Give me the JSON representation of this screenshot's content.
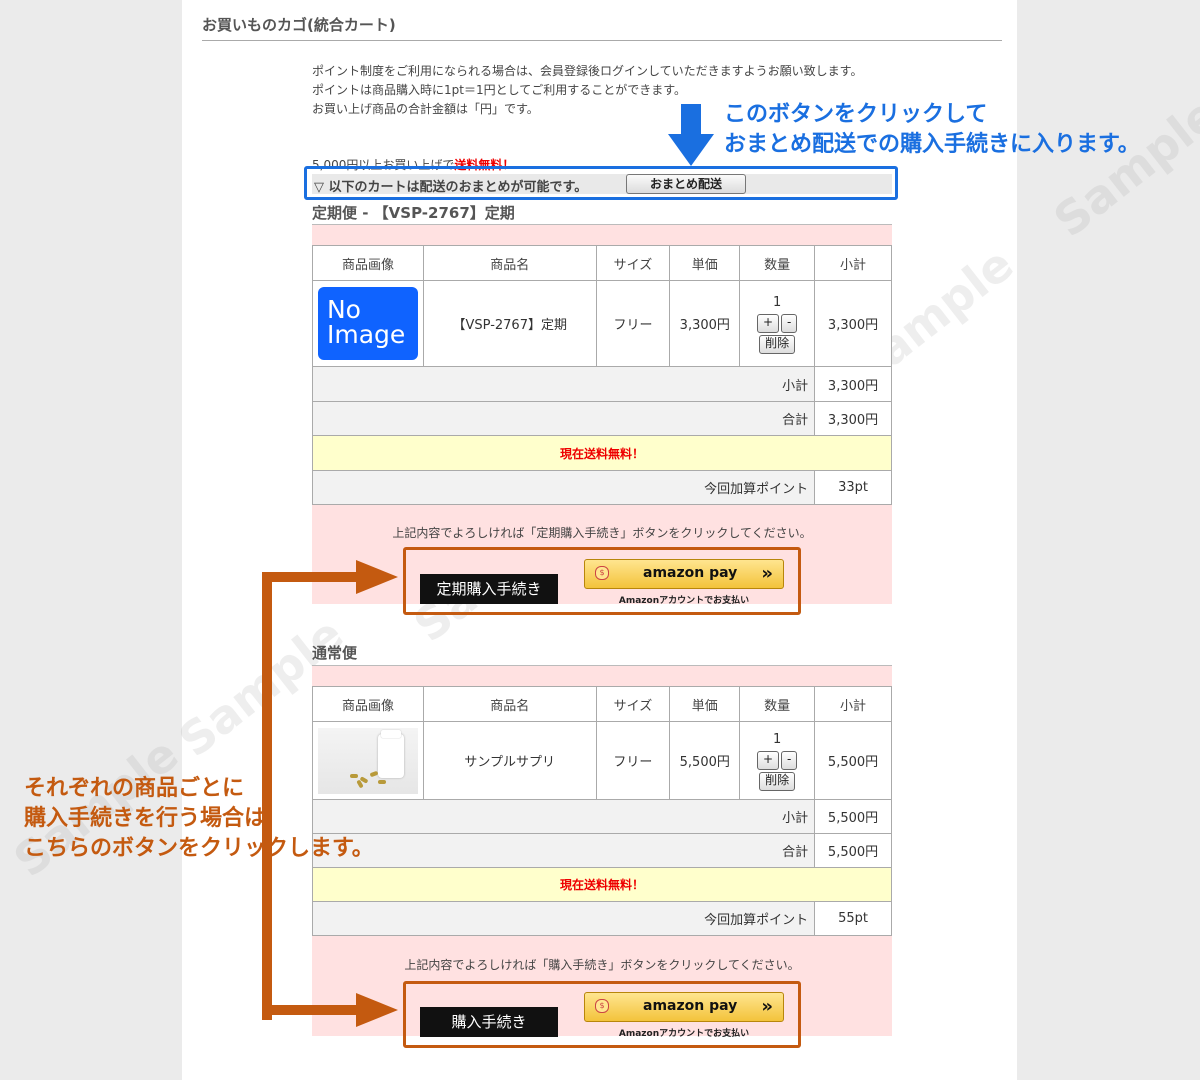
{
  "page_title": "お買いものカゴ(統合カート)",
  "info": {
    "line1": "ポイント制度をご利用になられる場合は、会員登録後ログインしていただきますようお願い致します。",
    "line2": "ポイントは商品購入時に1pt＝1円としてご利用することができます。",
    "line3": "お買い上げ商品の合計金額は「円」です。",
    "free_prefix": "5,000円以上お買い上げで",
    "free_suffix": "送料無料！"
  },
  "merge": {
    "label": "▽ 以下のカートは配送のおまとめが可能です。",
    "button": "おまとめ配送"
  },
  "callouts": {
    "blue_line1": "このボタンをクリックして",
    "blue_line2": "おまとめ配送での購入手続きに入ります。",
    "orange_line1": "それぞれの商品ごとに",
    "orange_line2": "購入手続きを行う場合は",
    "orange_line3": "こちらのボタンをクリックします。"
  },
  "watermark": "Sample",
  "table_headers": [
    "商品画像",
    "商品名",
    "サイズ",
    "単価",
    "数量",
    "小計"
  ],
  "qty_plus": "+",
  "qty_minus": "-",
  "delete_label": "削除",
  "subtotal_label": "小計",
  "total_label": "合計",
  "points_label": "今回加算ポイント",
  "free_shipping_now": "現在送料無料！",
  "amazon": {
    "logo": "amazon pay",
    "chevron": "»",
    "coin": "$",
    "sub": "Amazonアカウントでお支払い"
  },
  "cart1": {
    "title": "定期便 - 【VSP-2767】定期",
    "image_text_1": "No",
    "image_text_2": "Image",
    "product_name": "【VSP-2767】定期",
    "size": "フリー",
    "unit_price": "3,300円",
    "quantity": "1",
    "line_subtotal": "3,300円",
    "subtotal": "3,300円",
    "total": "3,300円",
    "points": "33pt",
    "note": "上記内容でよろしければ「定期購入手続き」ボタンをクリックしてください。",
    "checkout_button": "定期購入手続き"
  },
  "cart2": {
    "title": "通常便",
    "product_name": "サンプルサプリ",
    "size": "フリー",
    "unit_price": "5,500円",
    "quantity": "1",
    "line_subtotal": "5,500円",
    "subtotal": "5,500円",
    "total": "5,500円",
    "points": "55pt",
    "note": "上記内容でよろしければ「購入手続き」ボタンをクリックしてください。",
    "checkout_button": "購入手続き"
  }
}
